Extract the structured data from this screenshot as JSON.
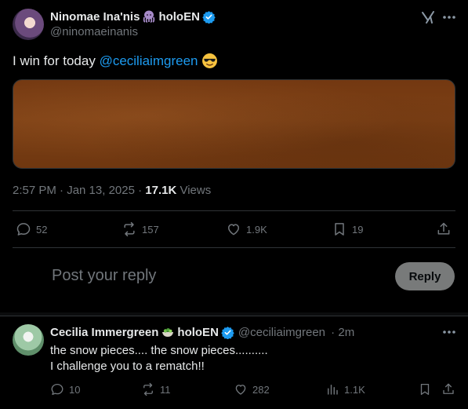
{
  "post": {
    "author_name": "Ninomae Ina'nis",
    "author_suffix": "holoEN",
    "handle": "@ninomaeinanis",
    "text_prefix": "I win for today ",
    "mention": "@ceciliaimgreen",
    "timestamp": "2:57 PM · Jan 13, 2025 · ",
    "views_count": "17.1K",
    "views_label": " Views",
    "stats": {
      "replies": "52",
      "reposts": "157",
      "likes": "1.9K",
      "bookmarks": "19"
    }
  },
  "composer": {
    "placeholder": "Post your reply",
    "button_label": "Reply"
  },
  "reply": {
    "author_name": "Cecilia Immergreen",
    "author_suffix": "holoEN",
    "handle": "@ceciliaimgreen",
    "time": " · 2m",
    "line1": "the snow pieces.... the snow pieces..........",
    "line2": "I challenge you to a rematch!!",
    "stats": {
      "replies": "10",
      "reposts": "11",
      "likes": "282",
      "views": "1.1K"
    }
  },
  "colors": {
    "accent": "#1d9bf0",
    "background": "#000000",
    "text": "#e7e9ea",
    "muted": "#71767b",
    "media_fill": "#7a3c12"
  },
  "icons": [
    "octopus-emoji-icon",
    "verified-badge-icon",
    "grok-icon",
    "more-icon",
    "cool-emoji-icon",
    "reply-icon",
    "repost-icon",
    "like-icon",
    "bookmark-icon",
    "share-icon",
    "views-icon",
    "salad-emoji-icon"
  ]
}
